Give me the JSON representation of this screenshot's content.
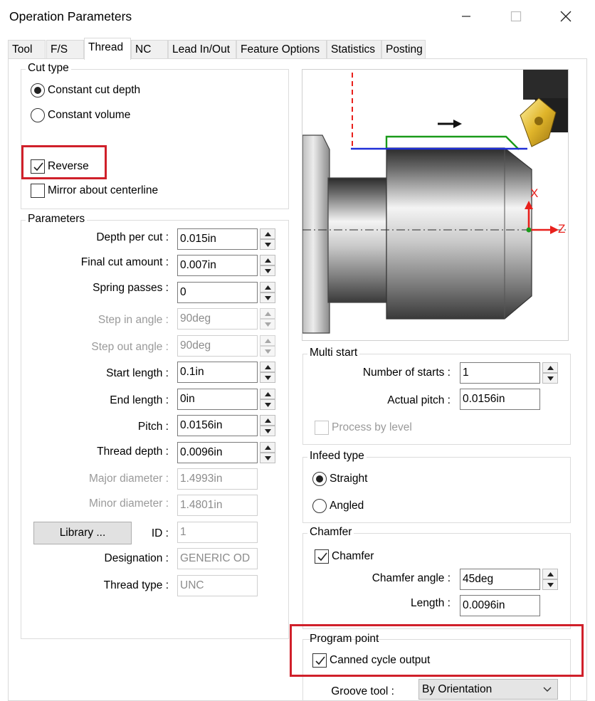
{
  "window": {
    "title": "Operation Parameters"
  },
  "tabs": [
    "Tool",
    "F/S",
    "Thread",
    "NC",
    "Lead In/Out",
    "Feature Options",
    "Statistics",
    "Posting"
  ],
  "cut_type": {
    "title": "Cut type",
    "options": [
      "Constant cut depth",
      "Constant volume"
    ],
    "selected": "Constant cut depth",
    "reverse_label": "Reverse",
    "reverse_checked": true,
    "mirror_label": "Mirror about centerline",
    "mirror_checked": false
  },
  "parameters": {
    "title": "Parameters",
    "rows": [
      {
        "label": "Depth per cut :",
        "value": "0.015in",
        "enabled": true,
        "spinner": true
      },
      {
        "label": "Final cut amount :",
        "value": "0.007in",
        "enabled": true,
        "spinner": true
      },
      {
        "label": "Spring passes :",
        "value": "0",
        "enabled": true,
        "spinner": true
      },
      {
        "label": "Step in angle :",
        "value": "90deg",
        "enabled": false,
        "spinner": true
      },
      {
        "label": "Step out angle :",
        "value": "90deg",
        "enabled": false,
        "spinner": true
      },
      {
        "label": "Start length :",
        "value": "0.1in",
        "enabled": true,
        "spinner": true
      },
      {
        "label": "End length :",
        "value": "0in",
        "enabled": true,
        "spinner": true
      },
      {
        "label": "Pitch :",
        "value": "0.0156in",
        "enabled": true,
        "spinner": true
      },
      {
        "label": "Thread depth :",
        "value": "0.0096in",
        "enabled": true,
        "spinner": true
      },
      {
        "label": "Major diameter :",
        "value": "1.4993in",
        "enabled": false,
        "spinner": false
      },
      {
        "label": "Minor diameter :",
        "value": "1.4801in",
        "enabled": false,
        "spinner": false
      }
    ],
    "library_button": "Library ...",
    "id_label": "ID :",
    "id_value": "1",
    "designation_label": "Designation :",
    "designation_value": "GENERIC OD",
    "thread_type_label": "Thread type :",
    "thread_type_value": "UNC"
  },
  "preview": {
    "x_axis_label": "X",
    "z_axis_label": "Z"
  },
  "multi_start": {
    "title": "Multi start",
    "starts_label": "Number of starts :",
    "starts_value": "1",
    "pitch_label": "Actual pitch :",
    "pitch_value": "0.0156in",
    "process_label": "Process by level",
    "process_checked": false
  },
  "infeed_type": {
    "title": "Infeed type",
    "options": [
      "Straight",
      "Angled"
    ],
    "selected": "Straight"
  },
  "chamfer": {
    "title": "Chamfer",
    "checkbox_label": "Chamfer",
    "checked": true,
    "angle_label": "Chamfer angle :",
    "angle_value": "45deg",
    "length_label": "Length :",
    "length_value": "0.0096in"
  },
  "program_point": {
    "title": "Program point",
    "canned_label": "Canned cycle output",
    "canned_checked": true,
    "groove_label": "Groove tool :",
    "groove_value": "By Orientation"
  },
  "colors": {
    "highlight": "#d0202a",
    "accent_green": "#1a9a1a",
    "accent_blue": "#1f2fd8",
    "axis_red": "#e8201c"
  }
}
